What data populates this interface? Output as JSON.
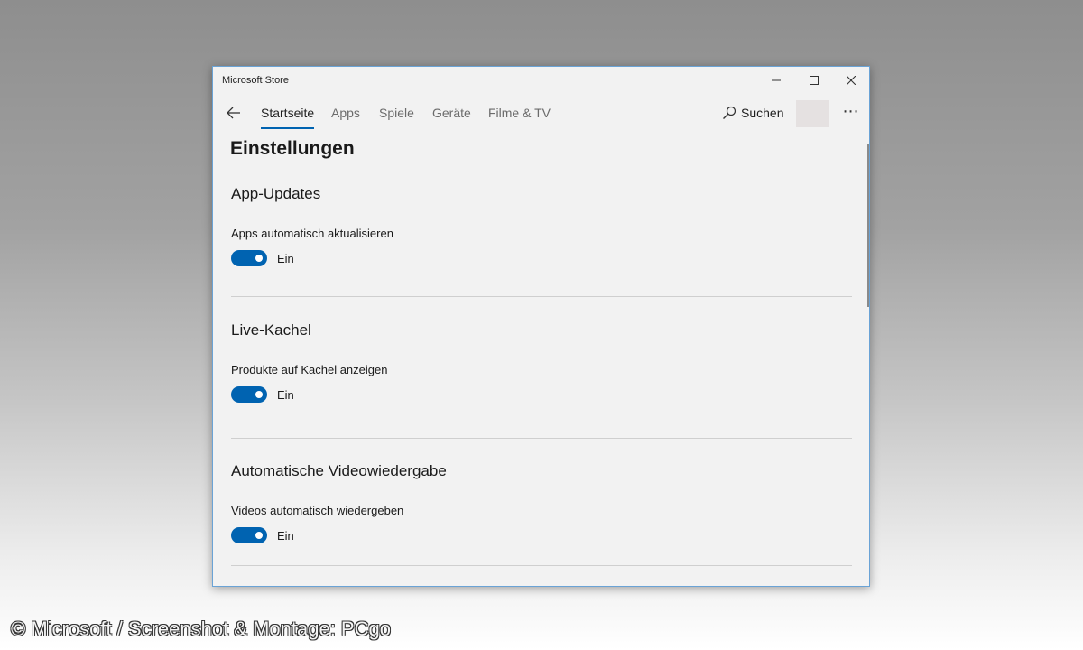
{
  "window": {
    "title": "Microsoft Store"
  },
  "nav": {
    "tabs": [
      {
        "label": "Startseite",
        "active": true
      },
      {
        "label": "Apps",
        "active": false
      },
      {
        "label": "Spiele",
        "active": false
      },
      {
        "label": "Geräte",
        "active": false
      },
      {
        "label": "Filme & TV",
        "active": false
      }
    ],
    "search_label": "Suchen",
    "more_label": "⋯"
  },
  "page": {
    "title": "Einstellungen",
    "sections": [
      {
        "title": "App-Updates",
        "setting": "Apps automatisch aktualisieren",
        "state": "Ein",
        "on": true
      },
      {
        "title": "Live-Kachel",
        "setting": "Produkte auf Kachel anzeigen",
        "state": "Ein",
        "on": true
      },
      {
        "title": "Automatische Videowiedergabe",
        "setting": "Videos automatisch wiedergeben",
        "state": "Ein",
        "on": true
      }
    ]
  },
  "colors": {
    "accent": "#0063b1",
    "window_bg": "#f2f2f2",
    "window_border": "#6aa3d6"
  },
  "watermark": "© Microsoft / Screenshot & Montage: PCgo"
}
